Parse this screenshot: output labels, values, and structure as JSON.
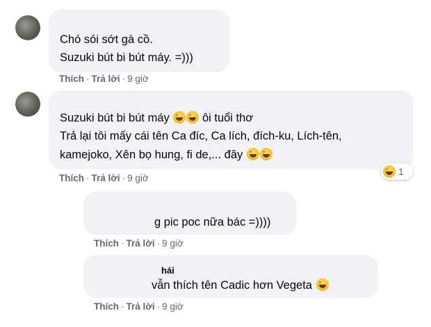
{
  "comments": [
    {
      "name": "",
      "lines": [
        "Chó sói sớt gà cồ.",
        "Suzuki bút bi bút máy. =)))"
      ],
      "actions": {
        "like": "Thích",
        "reply": "Trả lời",
        "time": "9 giờ"
      }
    },
    {
      "name": "",
      "lines": [
        "Suzuki bút bi bút máy",
        "ôi tuổi thơ",
        "Trả lại tôi mấy cái tên Ca đíc, Ca lích, đích-ku, Lích-tên,",
        "kamejoko, Xên bọ hung, fi de,... đây"
      ],
      "reaction_count": "1",
      "actions": {
        "like": "Thích",
        "reply": "Trả lời",
        "time": "9 giờ"
      }
    },
    {
      "name": "",
      "lines": [
        "g pic poc nữa bác =))))"
      ],
      "actions": {
        "like": "Thích",
        "reply": "Trả lời",
        "time": "9 giờ"
      }
    },
    {
      "name": "hái",
      "lines": [
        "vẫn thích tên Cadic hơn Vegeta"
      ],
      "actions": {
        "like": "Thích",
        "reply": "Trả lời",
        "time": "9 giờ"
      }
    }
  ],
  "emoji": {
    "icon": "laughing-emoji-icon",
    "color": "#f7b928"
  },
  "colors": {
    "bubble": "#f0f2f5",
    "meta": "#65676b",
    "text": "#050505"
  }
}
